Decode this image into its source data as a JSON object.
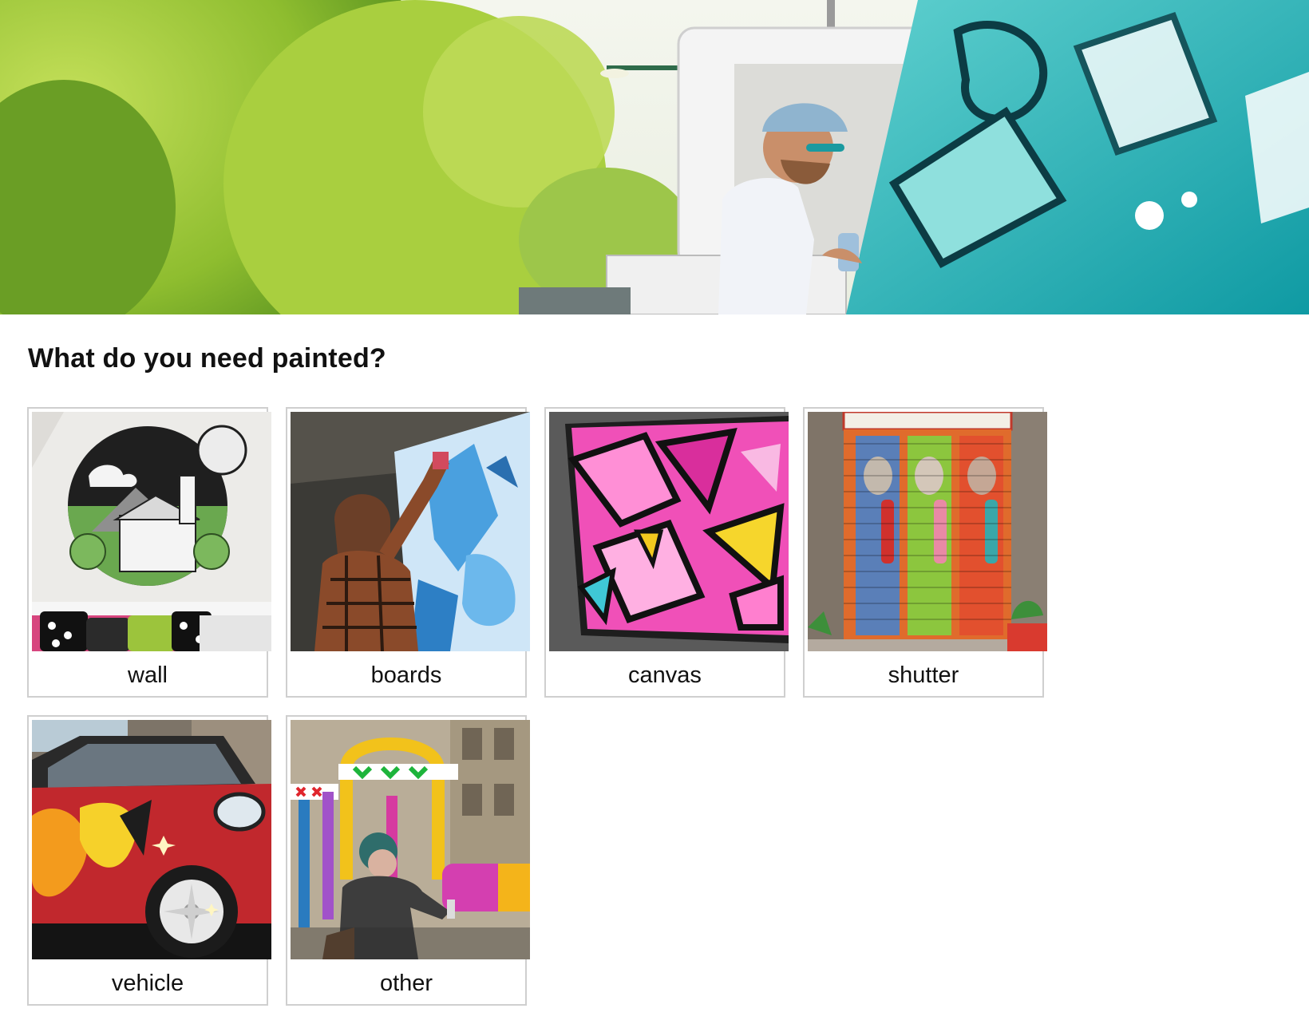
{
  "hero": {
    "image_alt": "street artist spray painting a mural on a truck"
  },
  "question": {
    "title": "What do you need painted?"
  },
  "options": [
    {
      "label": "wall"
    },
    {
      "label": "boards"
    },
    {
      "label": "canvas"
    },
    {
      "label": "shutter"
    },
    {
      "label": "vehicle"
    },
    {
      "label": "other"
    }
  ],
  "colors": {
    "card_border": "#cfcfcf",
    "text": "#111111",
    "accent_teal": "#1fb5b8",
    "accent_pink": "#e83fa8"
  }
}
